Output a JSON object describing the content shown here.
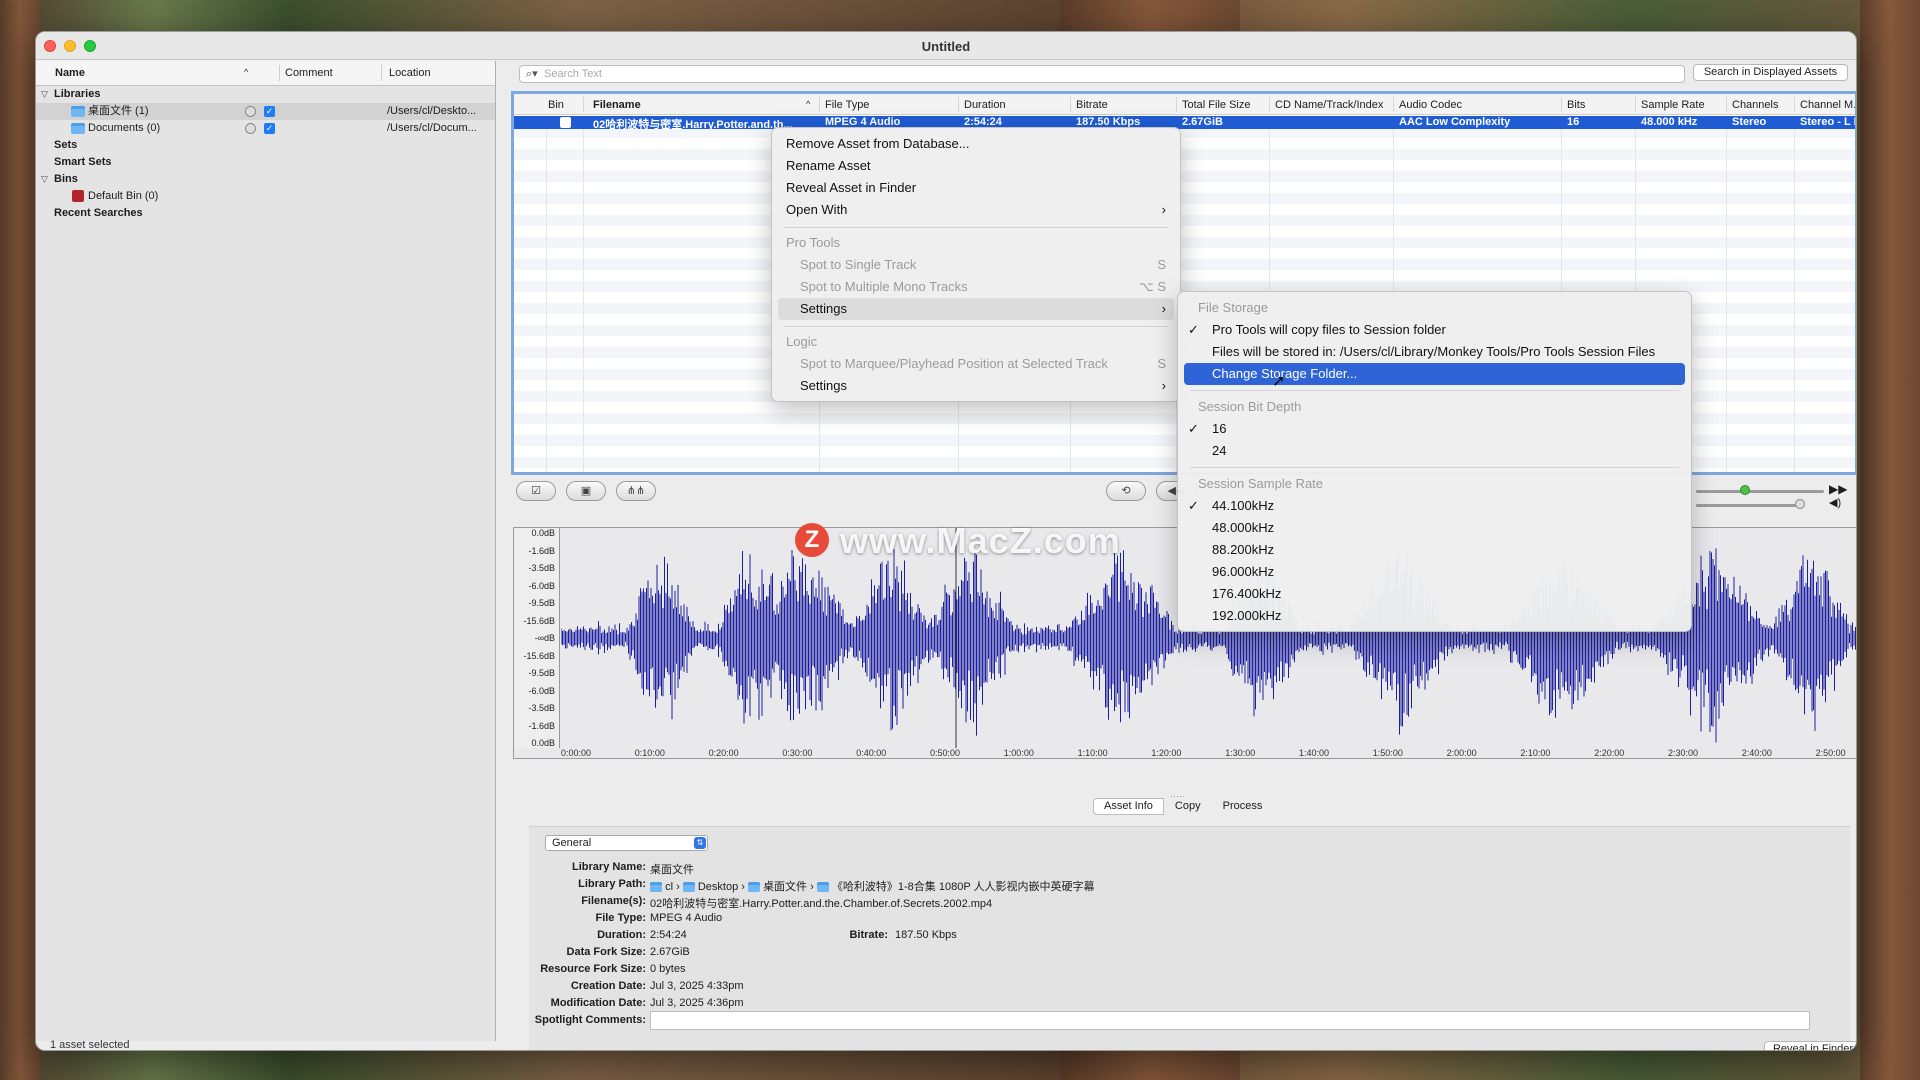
{
  "window": {
    "title": "Untitled"
  },
  "sidebar": {
    "columns": {
      "name": "Name",
      "comment": "Comment",
      "location": "Location"
    },
    "libraries_label": "Libraries",
    "libraries": [
      {
        "name": "桌面文件 (1)",
        "location": "/Users/cl/Deskto..."
      },
      {
        "name": "Documents (0)",
        "location": "/Users/cl/Docum..."
      }
    ],
    "sets_label": "Sets",
    "smart_sets_label": "Smart Sets",
    "bins_label": "Bins",
    "default_bin": "Default Bin (0)",
    "recent_searches": "Recent Searches",
    "status": "1 asset selected"
  },
  "search": {
    "placeholder": "Search Text",
    "button": "Search in Displayed Assets"
  },
  "table": {
    "headers": [
      "Bin",
      "Filename",
      "File Type",
      "Duration",
      "Bitrate",
      "Total File Size",
      "CD Name/Track/Index",
      "Audio Codec",
      "Bits",
      "Sample Rate",
      "Channels",
      "Channel M..."
    ],
    "row": {
      "filename": "02哈利波特与密室.Harry.Potter.and.th...",
      "file_type": "MPEG 4 Audio",
      "duration": "2:54:24",
      "bitrate": "187.50 Kbps",
      "total_size": "2.67GiB",
      "audio_codec": "AAC Low Complexity",
      "bits": "16",
      "sample_rate": "48.000 kHz",
      "channels": "Stereo",
      "channel_mode": "Stereo - L R"
    }
  },
  "waveform": {
    "db_labels": [
      "0.0dB",
      "-1.6dB",
      "-3.5dB",
      "-6.0dB",
      "-9.5dB",
      "-15.6dB",
      "-∞dB",
      "-15.6dB",
      "-9.5dB",
      "-6.0dB",
      "-3.5dB",
      "-1.6dB",
      "0.0dB"
    ],
    "time_labels": [
      "0:00:00",
      "0:10:00",
      "0:20:00",
      "0:30:00",
      "0:40:00",
      "0:50:00",
      "1:00:00",
      "1:10:00",
      "1:20:00",
      "1:30:00",
      "1:40:00",
      "1:50:00",
      "2:00:00",
      "2:10:00",
      "2:20:00",
      "2:30:00",
      "2:40:00",
      "2:50:00"
    ]
  },
  "watermark": {
    "logo": "Z",
    "text": "www.MacZ.com"
  },
  "tabs": [
    "Asset Info",
    "Copy",
    "Process"
  ],
  "info": {
    "select": "General",
    "library_name_label": "Library Name:",
    "library_name": "桌面文件",
    "library_path_label": "Library Path:",
    "library_path": [
      "cl",
      "Desktop",
      "桌面文件",
      "《哈利波特》1-8合集 1080P 人人影视内嵌中英硬字幕"
    ],
    "filenames_label": "Filename(s):",
    "filenames": "02哈利波特与密室.Harry.Potter.and.the.Chamber.of.Secrets.2002.mp4",
    "file_type_label": "File Type:",
    "file_type": "MPEG 4 Audio",
    "duration_label": "Duration:",
    "duration": "2:54:24",
    "bitrate_label": "Bitrate:",
    "bitrate": "187.50 Kbps",
    "data_fork_label": "Data Fork Size:",
    "data_fork": "2.67GiB",
    "resource_fork_label": "Resource Fork Size:",
    "resource_fork": "0 bytes",
    "creation_label": "Creation Date:",
    "creation": "Jul 3, 2025 4:33pm",
    "modification_label": "Modification Date:",
    "modification": "Jul 3, 2025 4:36pm",
    "spotlight_label": "Spotlight Comments:",
    "reveal_button": "Reveal in Finder"
  },
  "context_menu": {
    "remove": "Remove Asset from Database...",
    "rename": "Rename Asset",
    "reveal": "Reveal Asset in Finder",
    "open_with": "Open With",
    "pro_tools_header": "Pro Tools",
    "spot_single": "Spot to Single Track",
    "spot_single_sc": "S",
    "spot_multi": "Spot to Multiple Mono Tracks",
    "spot_multi_sc": "⌥ S",
    "settings": "Settings",
    "logic_header": "Logic",
    "spot_marquee": "Spot to Marquee/Playhead Position at Selected Track",
    "spot_marquee_sc": "S",
    "logic_settings": "Settings"
  },
  "submenu": {
    "file_storage_header": "File Storage",
    "copy_files": "Pro Tools will copy files to Session folder",
    "stored_in": "Files will be stored in: /Users/cl/Library/Monkey Tools/Pro Tools Session Files",
    "change_folder": "Change Storage Folder...",
    "bit_depth_header": "Session Bit Depth",
    "bit_16": "16",
    "bit_24": "24",
    "sample_rate_header": "Session Sample Rate",
    "rates": [
      "44.100kHz",
      "48.000kHz",
      "88.200kHz",
      "96.000kHz",
      "176.400kHz",
      "192.000kHz"
    ]
  },
  "colors": {
    "accent": "#2f64d7",
    "waveform": "#1c1fa0"
  }
}
